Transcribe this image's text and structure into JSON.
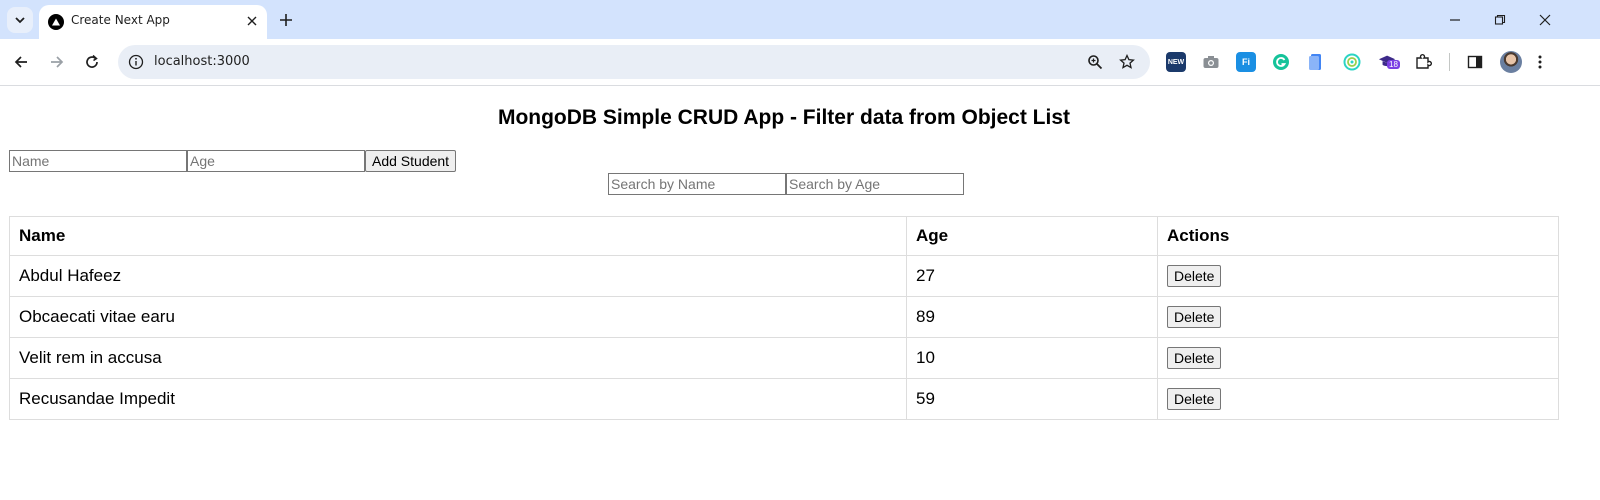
{
  "browser": {
    "tab_title": "Create Next App",
    "url": "localhost:3000",
    "extension_badge": "18",
    "extension_icon_labels": {
      "new": "NEW",
      "fi": "Fi"
    }
  },
  "page": {
    "title": "MongoDB Simple CRUD App - Filter data from Object List",
    "form": {
      "name_placeholder": "Name",
      "age_placeholder": "Age",
      "add_button": "Add Student"
    },
    "search": {
      "name_placeholder": "Search by Name",
      "age_placeholder": "Search by Age"
    },
    "table": {
      "headers": [
        "Name",
        "Age",
        "Actions"
      ],
      "rows": [
        {
          "name": "Abdul Hafeez",
          "age": "27",
          "action": "Delete"
        },
        {
          "name": "Obcaecati vitae earu",
          "age": "89",
          "action": "Delete"
        },
        {
          "name": "Velit rem in accusa",
          "age": "10",
          "action": "Delete"
        },
        {
          "name": "Recusandae Impedit",
          "age": "59",
          "action": "Delete"
        }
      ]
    }
  },
  "icons": {
    "tab_search": "chevron-down-icon",
    "favicon": "nextjs-triangle-icon",
    "tab_close": "close-icon",
    "new_tab": "plus-icon",
    "minimize": "minimize-icon",
    "restore": "restore-icon",
    "window_close": "close-icon",
    "back": "arrow-left-icon",
    "forward": "arrow-right-icon",
    "reload": "reload-icon",
    "site_info": "info-icon",
    "zoom": "zoom-icon",
    "bookmark": "star-icon",
    "extensions": "puzzle-icon",
    "side_panel": "side-panel-icon",
    "menu": "more-vert-icon"
  },
  "colors": {
    "tabstrip": "#d3e3fd",
    "omnibox": "#e9eef6",
    "table_border": "#dddddd"
  }
}
